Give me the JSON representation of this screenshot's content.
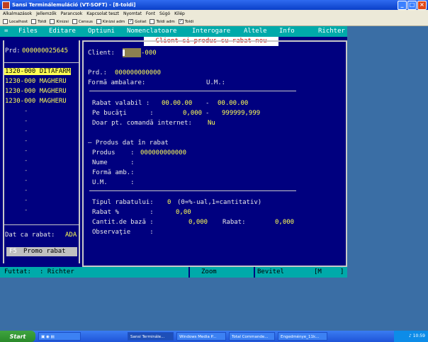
{
  "window": {
    "title": "Sansi Terminálemuláció (VT-SOFT) - [8-toldi]"
  },
  "menubar": [
    "Alkalmazások",
    "Jellemzők",
    "Parancsok",
    "Kapcsolat teszt",
    "Nyomtat",
    "Font",
    "Súgó",
    "Kilép"
  ],
  "toolbar": [
    {
      "label": "Localhost",
      "checked": false
    },
    {
      "label": "Toldi",
      "checked": false
    },
    {
      "label": "Kinizsi",
      "checked": false
    },
    {
      "label": "Census",
      "checked": false
    },
    {
      "label": "Kinizsi adm",
      "checked": false
    },
    {
      "label": "Goliat",
      "checked": true
    },
    {
      "label": "Toldi adm",
      "checked": false
    },
    {
      "label": "Toldi",
      "checked": true
    }
  ],
  "terminal_menu": {
    "marker": "=",
    "items": [
      "Files",
      "Editare",
      "Optiuni",
      "Nomenclatoare",
      "Interogare",
      "Altele",
      "Info"
    ],
    "user": "Richter"
  },
  "popup": "Client si produs cu rabat nou",
  "left": {
    "prd_label": "Prd:",
    "prd_value": "000000025645",
    "rows": [
      "1320-000 DITAFARM",
      "1230-000 MAGHERU",
      "1230-000 MAGHERU",
      "1230-000 MAGHERU"
    ],
    "empty_marker": "-",
    "dat_label": "Dat ca rabat:",
    "dat_value": "ADA",
    "promo_key": "F5",
    "promo_label": "Promo rabat"
  },
  "form": {
    "client_label": "Client:",
    "client_suffix": "-000",
    "prd_label": "Prd.:",
    "prd_value": "000000000000",
    "forma_label": "Formă ambalare:",
    "um_label": "U.M.:",
    "rabat_valabil_label": "Rabat valabil :",
    "date_from": "00.00.00",
    "date_sep": "-",
    "date_to": "00.00.00",
    "pe_bucati_label": "Pe bucăţi      :",
    "pe_bucati_from": "0,000",
    "pe_bucati_to": "999999,999",
    "internet_label": "Doar pt. comandă internet:",
    "internet_value": "Nu",
    "produs_header": "— Produs dat în rabat",
    "produs_label": "Produs    :",
    "produs_value": "000000000000",
    "nume_label": "Nume      :",
    "forma_amb_label": "Formă amb.:",
    "um2_label": "U.M.      :",
    "tipul_label": "Tipul rabatului:",
    "tipul_value": "0",
    "tipul_hint": "(0=%-ual,1=cantitativ)",
    "rabat_pct_label": "Rabat %        :",
    "rabat_pct_value": "0,00",
    "cantit_label": "Cantit.de bază :",
    "cantit_value": "0,000",
    "rabat_label": "Rabat:",
    "rabat_value": "0,000",
    "observatie_label": "Observaţie     :"
  },
  "status": {
    "user_label": "Futtat:",
    "user_value": ": Richter",
    "zoom": "Zoom",
    "mode": "Bevitel",
    "mode_key": "[M",
    "mode_end": "]"
  },
  "taskbar": {
    "start": "Start",
    "tasks": [
      "Sansi Terminále...",
      "Windows Media P...",
      "Total Commande...",
      "Engedménye_11k..."
    ],
    "clock": "10:59"
  },
  "colors": {
    "terminal_bg": "#00007f",
    "cyan_bar": "#00aaaa",
    "yellow_text": "#ffff54",
    "popup_text": "#c00000",
    "xp_blue": "#0a3fc8"
  }
}
